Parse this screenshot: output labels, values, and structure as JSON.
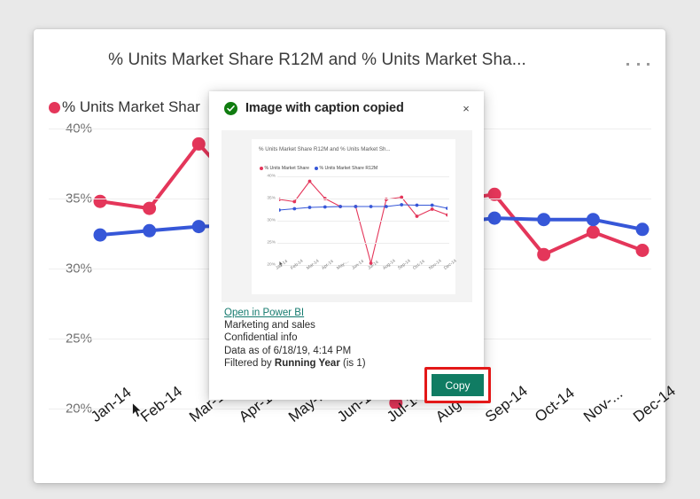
{
  "visual": {
    "title": "% Units Market Share R12M and % Units Market Sha...",
    "more_menu_label": "More options",
    "legend": [
      {
        "label": "% Units Market Shar",
        "color": "#e4365a"
      }
    ]
  },
  "dialog": {
    "title": "Image with caption copied",
    "check_icon": "check-circle-icon",
    "close_label": "×",
    "caption": {
      "link": "Open in Power BI",
      "workspace": "Marketing and sales",
      "sensitivity": "Confidential info",
      "data_as_of": "Data as of 6/18/19, 4:14 PM",
      "filter_prefix": "Filtered by ",
      "filter_name": "Running Year",
      "filter_value": " (is 1)"
    },
    "copy_button": "Copy",
    "copy_button_color": "#107c63",
    "highlight_color": "#e31818"
  },
  "chart_data": [
    {
      "id": "main-chart",
      "type": "line",
      "title": "% Units Market Share R12M and % Units Market Sha...",
      "xlabel": "",
      "ylabel": "",
      "ylim": [
        20,
        40
      ],
      "yticks": [
        40,
        35,
        30,
        25,
        20
      ],
      "ytick_labels": [
        "40%",
        "35%",
        "30%",
        "25%",
        "20%"
      ],
      "grid": true,
      "legend_position": "top-left",
      "categories": [
        "Jan-14",
        "Feb-14",
        "Mar-14",
        "Apr-14",
        "May-...",
        "Jun-14",
        "Jul-14",
        "Aug-14",
        "Sep-14",
        "Oct-14",
        "Nov-...",
        "Dec-14"
      ],
      "series": [
        {
          "name": "% Units Market Share",
          "color": "#e4365a",
          "values": [
            34.8,
            34.3,
            38.9,
            35.0,
            33.2,
            33.2,
            20.4,
            34.8,
            35.3,
            31.0,
            32.6,
            31.3
          ]
        },
        {
          "name": "% Units Market Share R12M",
          "color": "#3657d8",
          "values": [
            32.4,
            32.7,
            33.0,
            33.1,
            33.2,
            33.2,
            33.2,
            33.2,
            33.6,
            33.5,
            33.5,
            32.8
          ]
        }
      ]
    },
    {
      "id": "thumbnail-chart",
      "type": "line",
      "title": "% Units Market Share R12M and % Units Market Sh...",
      "xlabel": "",
      "ylabel": "",
      "ylim": [
        20,
        40
      ],
      "yticks": [
        40,
        35,
        30,
        25,
        20
      ],
      "ytick_labels": [
        "40%",
        "35%",
        "30%",
        "25%",
        "20%"
      ],
      "grid": true,
      "legend_position": "top-left",
      "categories": [
        "Jan-14",
        "Feb-14",
        "Mar-14",
        "Apr-14",
        "May-...",
        "Jun-14",
        "Jul-14",
        "Aug-14",
        "Sep-14",
        "Oct-14",
        "Nov-14",
        "Dec-14"
      ],
      "series": [
        {
          "name": "% Units Market Share",
          "color": "#e4365a",
          "values": [
            34.8,
            34.3,
            38.9,
            35.0,
            33.2,
            33.2,
            20.4,
            34.8,
            35.3,
            31.0,
            32.6,
            31.3
          ]
        },
        {
          "name": "% Units Market Share R12M",
          "color": "#3657d8",
          "values": [
            32.4,
            32.7,
            33.0,
            33.1,
            33.2,
            33.2,
            33.2,
            33.2,
            33.6,
            33.5,
            33.5,
            32.8
          ]
        }
      ]
    }
  ]
}
